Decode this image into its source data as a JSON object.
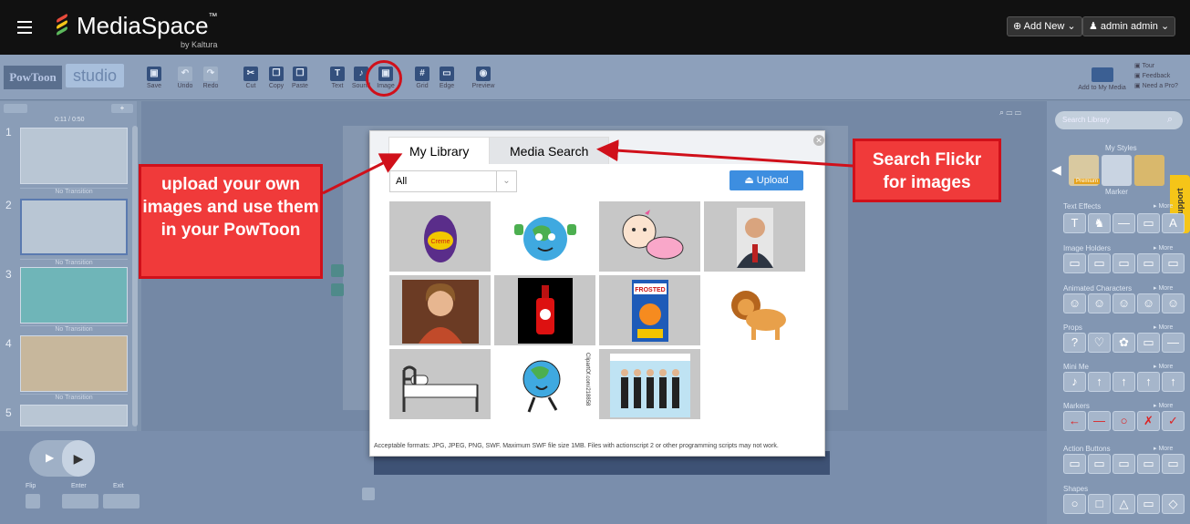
{
  "header": {
    "brand": "MediaSpace",
    "trademark": "™",
    "sub": "by Kaltura",
    "add_new": "⊕ Add New",
    "user": "admin admin"
  },
  "toolbar": {
    "logo": "PowToon",
    "studio": "studio",
    "tools": [
      "Save",
      "Undo",
      "Redo",
      "Cut",
      "Copy",
      "Paste",
      "Text",
      "Sound",
      "Image",
      "Grid",
      "Edge",
      "Preview"
    ],
    "add_to_media": "Add to My Media",
    "tour": "Tour",
    "feedback": "Feedback",
    "need_pro": "Need a Pro?"
  },
  "slides": {
    "time": "0:11 / 0:50",
    "numbers": [
      "1",
      "2",
      "3",
      "4",
      "5"
    ],
    "transition": "No Transition"
  },
  "right": {
    "search_placeholder": "Search Library",
    "my_styles": "My Styles",
    "premium": "Premium",
    "marker": "Marker",
    "sections": [
      "Text Effects",
      "Image Holders",
      "Animated Characters",
      "Props",
      "Mini Me",
      "Markers",
      "Action Buttons",
      "Shapes"
    ],
    "more": "▸ More",
    "support": "Support"
  },
  "bottom": {
    "flip": "Flip",
    "enter": "Enter",
    "exit": "Exit"
  },
  "modal": {
    "tab_library": "My Library",
    "tab_search": "Media Search",
    "filter": "All",
    "upload": "Upload",
    "footer": "Acceptable formats: JPG, JPEG, PNG, SWF. Maximum SWF file size 1MB. Files with actionscript 2 or other programming scripts may not work.",
    "clipart_credit": "ClipartOf.com/218858",
    "items": [
      "easter-egg",
      "earth-thumbs-up",
      "baby-crawling",
      "man-portrait",
      "woman-portrait",
      "hot-sauce-bottle",
      "frosted-flakes-box",
      "lion",
      "bed",
      "earth-walking",
      "group-photo"
    ]
  },
  "callouts": {
    "upload_note": "upload your own images and use them in your PowToon",
    "search_note": "Search Flickr for images"
  },
  "colors": {
    "topbar": "#111111",
    "accent_red": "#d0101a",
    "upload_blue": "#3d8ee0"
  }
}
